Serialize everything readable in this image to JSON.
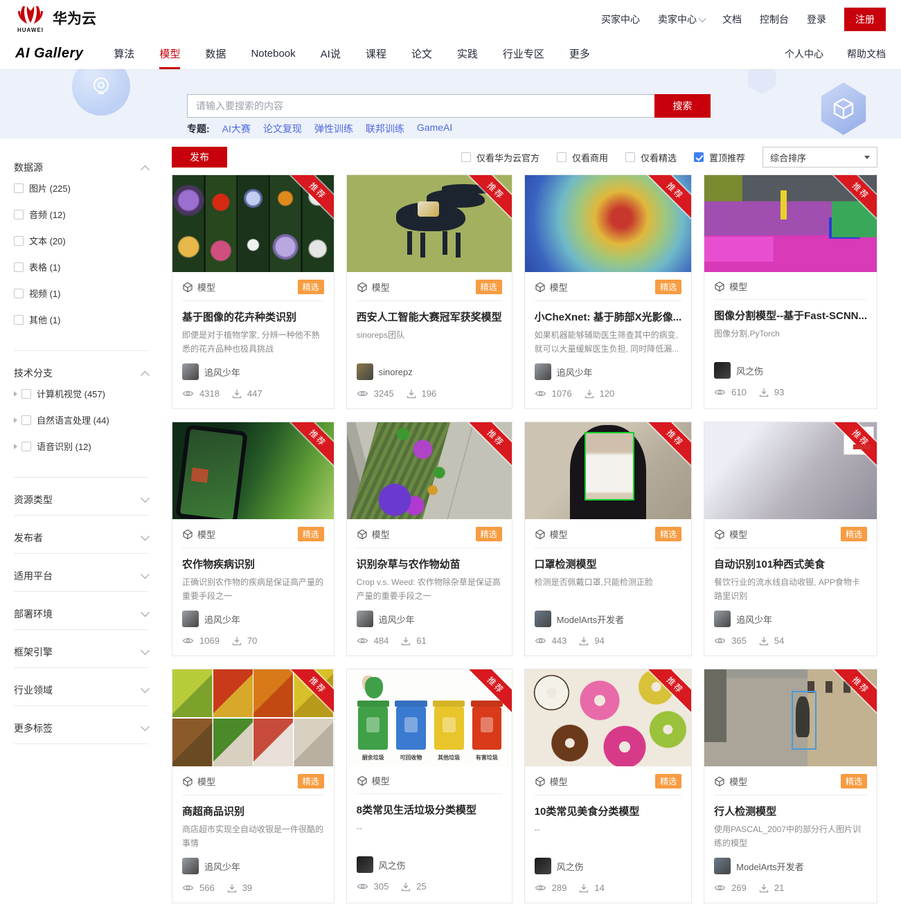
{
  "topbar": {
    "brand_name": "华为云",
    "links": [
      {
        "label": "买家中心",
        "caret": false
      },
      {
        "label": "卖家中心",
        "caret": true
      },
      {
        "label": "文档",
        "caret": false
      },
      {
        "label": "控制台",
        "caret": false
      },
      {
        "label": "登录",
        "caret": false
      }
    ],
    "register_label": "注册"
  },
  "subnav": {
    "logo": "AI Gallery",
    "tabs": [
      "算法",
      "模型",
      "数据",
      "Notebook",
      "AI说",
      "课程",
      "论文",
      "实践",
      "行业专区",
      "更多"
    ],
    "active_tab": "模型",
    "right_links": [
      "个人中心",
      "帮助文档"
    ]
  },
  "banner": {
    "search_placeholder": "请输入要搜索的内容",
    "search_button": "搜索",
    "topics_label": "专题:",
    "topics": [
      "AI大赛",
      "论文复现",
      "弹性训练",
      "联邦训练",
      "GameAI"
    ]
  },
  "sidebar": {
    "sections": [
      {
        "title": "数据源",
        "expanded": true,
        "items": [
          {
            "label": "图片",
            "count": "225",
            "expandable": false
          },
          {
            "label": "音频",
            "count": "12",
            "expandable": false
          },
          {
            "label": "文本",
            "count": "20",
            "expandable": false
          },
          {
            "label": "表格",
            "count": "1",
            "expandable": false
          },
          {
            "label": "视频",
            "count": "1",
            "expandable": false
          },
          {
            "label": "其他",
            "count": "1",
            "expandable": false
          }
        ]
      },
      {
        "title": "技术分支",
        "expanded": true,
        "items": [
          {
            "label": "计算机视觉",
            "count": "457",
            "expandable": true
          },
          {
            "label": "自然语言处理",
            "count": "44",
            "expandable": true
          },
          {
            "label": "语音识别",
            "count": "12",
            "expandable": true
          }
        ]
      },
      {
        "title": "资源类型",
        "expanded": false,
        "items": []
      },
      {
        "title": "发布者",
        "expanded": false,
        "items": []
      },
      {
        "title": "适用平台",
        "expanded": false,
        "items": []
      },
      {
        "title": "部署环境",
        "expanded": false,
        "items": []
      },
      {
        "title": "框架引擎",
        "expanded": false,
        "items": []
      },
      {
        "title": "行业领域",
        "expanded": false,
        "items": []
      },
      {
        "title": "更多标签",
        "expanded": false,
        "items": []
      }
    ]
  },
  "toolbar": {
    "publish_label": "发布",
    "filters": [
      {
        "label": "仅看华为云官方",
        "checked": false
      },
      {
        "label": "仅看商用",
        "checked": false
      },
      {
        "label": "仅看精选",
        "checked": false
      },
      {
        "label": "置顶推荐",
        "checked": true
      }
    ],
    "sort_value": "综合排序"
  },
  "badge_color": "#f79c42",
  "accent_red": "#c7000b",
  "checkbox_blue": "#3d7ff3",
  "cards": [
    {
      "type": "模型",
      "ribbon": "推荐",
      "featured": true,
      "title": "基于图像的花卉种类识别",
      "desc": "即便是对于植物学家, 分辨一种他不熟悉的花卉品种也极具挑战",
      "author": "追风少年",
      "avatar_color": "#9aa0a6",
      "views": "4318",
      "downloads": "447",
      "thumb": "flowers"
    },
    {
      "type": "模型",
      "ribbon": "推荐",
      "featured": true,
      "title": "西安人工智能大赛冠军获奖模型",
      "desc": "sinoreps团队",
      "author": "sinorepz",
      "avatar_color": "#8a7a4a",
      "views": "3245",
      "downloads": "196",
      "thumb": "horse"
    },
    {
      "type": "模型",
      "ribbon": "推荐",
      "featured": true,
      "title": "小CheXnet: 基于肺部X光影像...",
      "desc": "如果机器能够辅助医生筛查其中的病变, 就可以大量缓解医生负担, 同时降低漏...",
      "author": "追风少年",
      "avatar_color": "#9aa0a6",
      "views": "1076",
      "downloads": "120",
      "thumb": "xray"
    },
    {
      "type": "模型",
      "ribbon": "推荐",
      "featured": false,
      "title": "图像分割模型--基于Fast-SCNN...",
      "desc": "图像分割,PyTorch",
      "author": "风之伤",
      "avatar_color": "#1a1a1a",
      "views": "610",
      "downloads": "93",
      "thumb": "seg"
    },
    {
      "type": "模型",
      "ribbon": "推荐",
      "featured": true,
      "title": "农作物疾病识别",
      "desc": "正确识别农作物的疾病是保证高产量的重要手段之一",
      "author": "追风少年",
      "avatar_color": "#9aa0a6",
      "views": "1069",
      "downloads": "70",
      "thumb": "leaf"
    },
    {
      "type": "模型",
      "ribbon": "推荐",
      "featured": true,
      "title": "识别杂草与农作物幼苗",
      "desc": "Crop v.s. Weed: 农作物除杂草是保证高产量的重要手段之一",
      "author": "追风少年",
      "avatar_color": "#9aa0a6",
      "views": "484",
      "downloads": "61",
      "thumb": "weed"
    },
    {
      "type": "模型",
      "ribbon": "推荐",
      "featured": true,
      "title": "口罩检测模型",
      "desc": "检测是否佩戴口罩,只能检测正脸",
      "author": "ModelArts开发者",
      "avatar_color": "#6a7a8a",
      "views": "443",
      "downloads": "94",
      "thumb": "mask"
    },
    {
      "type": "模型",
      "ribbon": "推荐",
      "featured": true,
      "title": "自动识别101种西式美食",
      "desc": "餐饮行业的流水线自动收银, APP食物卡路里识别",
      "author": "追风少年",
      "avatar_color": "#9aa0a6",
      "views": "365",
      "downloads": "54",
      "thumb": "blur"
    },
    {
      "type": "模型",
      "ribbon": "推荐",
      "featured": true,
      "title": "商超商品识别",
      "desc": "商店超市实现全自动收银是一件很酷的事情",
      "author": "追风少年",
      "avatar_color": "#9aa0a6",
      "views": "566",
      "downloads": "39",
      "thumb": "fruit"
    },
    {
      "type": "模型",
      "ribbon": "推荐",
      "featured": false,
      "title": "8类常见生活垃圾分类模型",
      "desc": "--",
      "author": "风之伤",
      "avatar_color": "#1a1a1a",
      "views": "305",
      "downloads": "25",
      "thumb": "bins",
      "bin_labels": [
        "厨余垃圾",
        "可回收物",
        "其他垃圾",
        "有害垃圾"
      ]
    },
    {
      "type": "模型",
      "ribbon": "推荐",
      "featured": true,
      "title": "10类常见美食分类模型",
      "desc": "--",
      "author": "风之伤",
      "avatar_color": "#1a1a1a",
      "views": "289",
      "downloads": "14",
      "thumb": "donut"
    },
    {
      "type": "模型",
      "ribbon": "推荐",
      "featured": true,
      "title": "行人检测模型",
      "desc": "使用PASCAL_2007中的部分行人图片训练的模型",
      "author": "ModelArts开发者",
      "avatar_color": "#6a7a8a",
      "views": "269",
      "downloads": "21",
      "thumb": "street"
    }
  ]
}
